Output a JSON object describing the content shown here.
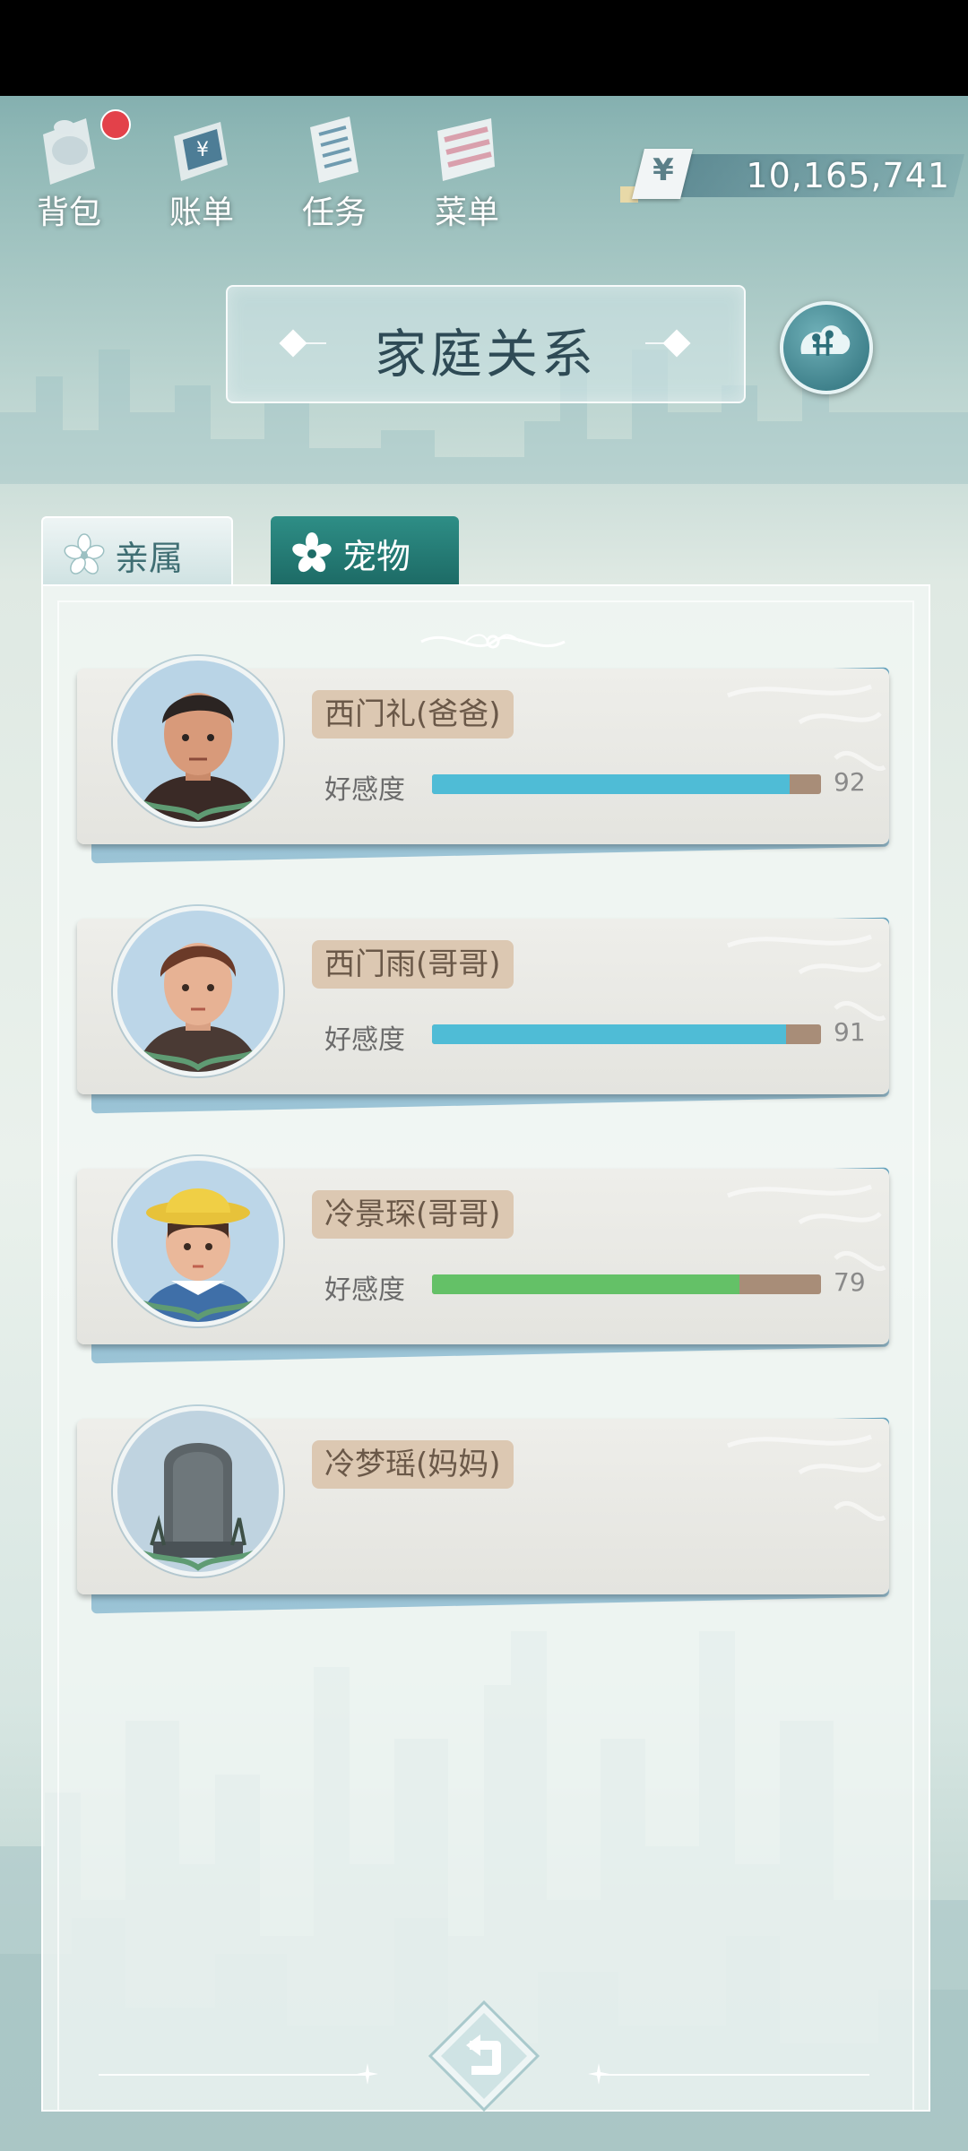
{
  "top_menu": [
    {
      "label": "背包",
      "icon": "backpack-icon",
      "has_notification": true
    },
    {
      "label": "账单",
      "icon": "bill-icon",
      "has_notification": false
    },
    {
      "label": "任务",
      "icon": "task-list-icon",
      "has_notification": false
    },
    {
      "label": "菜单",
      "icon": "menu-icon",
      "has_notification": false
    }
  ],
  "currency": {
    "symbol": "¥",
    "value": "10,165,741"
  },
  "title": "家庭关系",
  "tabs": [
    {
      "label": "亲属",
      "icon": "flower-icon",
      "active": false
    },
    {
      "label": "宠物",
      "icon": "flower-icon",
      "active": true
    }
  ],
  "relatives": [
    {
      "name": "西门礼(爸爸)",
      "affection_label": "好感度",
      "affection": 92,
      "bar_color": "#4fbcd6",
      "avatar": "father-avatar"
    },
    {
      "name": "西门雨(哥哥)",
      "affection_label": "好感度",
      "affection": 91,
      "bar_color": "#4fbcd6",
      "avatar": "brother-avatar"
    },
    {
      "name": "冷景琛(哥哥)",
      "affection_label": "好感度",
      "affection": 79,
      "bar_color": "#64c167",
      "avatar": "brother-yellow-hat-avatar"
    },
    {
      "name": "冷梦瑶(妈妈)",
      "affection_label": null,
      "affection": null,
      "bar_color": null,
      "avatar": "tombstone-avatar"
    }
  ],
  "colors": {
    "accent_teal": "#1d6b66",
    "bar_track": "#a88d78",
    "name_tag": "#dcc8b2"
  }
}
